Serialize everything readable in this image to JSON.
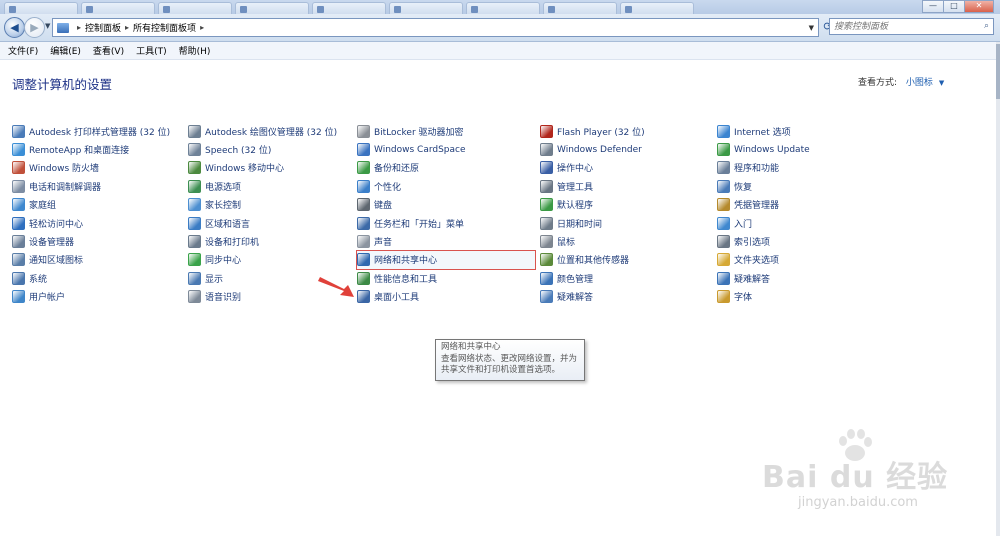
{
  "window": {
    "tabs_count": 9,
    "controls": {
      "minimize": "—",
      "maximize": "□",
      "close": "✕"
    }
  },
  "nav": {
    "back_icon": "back-arrow-icon",
    "breadcrumb": [
      "控制面板",
      "所有控制面板项"
    ],
    "search_placeholder": "搜索控制面板"
  },
  "menu": [
    "文件(F)",
    "编辑(E)",
    "查看(V)",
    "工具(T)",
    "帮助(H)"
  ],
  "header": {
    "title": "调整计算机的设置",
    "view_by_label": "查看方式:",
    "view_by_value": "小图标"
  },
  "columns": [
    [
      {
        "label": "Autodesk 打印样式管理器 (32 位)",
        "color": "#4a7bb8"
      },
      {
        "label": "RemoteApp 和桌面连接",
        "color": "#3b8fd6"
      },
      {
        "label": "Windows 防火墙",
        "color": "#c0503a"
      },
      {
        "label": "电话和调制解调器",
        "color": "#7d8da3"
      },
      {
        "label": "家庭组",
        "color": "#3f88cf"
      },
      {
        "label": "轻松访问中心",
        "color": "#2f6fbf"
      },
      {
        "label": "设备管理器",
        "color": "#6a7f99"
      },
      {
        "label": "通知区域图标",
        "color": "#5a7ea8"
      },
      {
        "label": "系统",
        "color": "#4a76ad"
      },
      {
        "label": "用户帐户",
        "color": "#3f86c9"
      }
    ],
    [
      {
        "label": "Autodesk 绘图仪管理器 (32 位)",
        "color": "#6d7f92"
      },
      {
        "label": "Speech (32 位)",
        "color": "#6f8298"
      },
      {
        "label": "Windows 移动中心",
        "color": "#4c8a3f"
      },
      {
        "label": "电源选项",
        "color": "#3d8f52"
      },
      {
        "label": "家长控制",
        "color": "#4d8fd1"
      },
      {
        "label": "区域和语言",
        "color": "#3b7cc4"
      },
      {
        "label": "设备和打印机",
        "color": "#6a7a8c"
      },
      {
        "label": "同步中心",
        "color": "#3aa34a"
      },
      {
        "label": "显示",
        "color": "#4a79b2"
      },
      {
        "label": "语音识别",
        "color": "#7e8a98"
      }
    ],
    [
      {
        "label": "BitLocker 驱动器加密",
        "color": "#8a8f96"
      },
      {
        "label": "Windows CardSpace",
        "color": "#3a73c0"
      },
      {
        "label": "备份和还原",
        "color": "#3b9a45"
      },
      {
        "label": "个性化",
        "color": "#3b7fc9"
      },
      {
        "label": "键盘",
        "color": "#5e6770"
      },
      {
        "label": "任务栏和「开始」菜单",
        "color": "#3c6aa8"
      },
      {
        "label": "声音",
        "color": "#8b94a0"
      },
      {
        "label": "网络和共享中心",
        "color": "#2f69b0",
        "highlight": true
      },
      {
        "label": "性能信息和工具",
        "color": "#3c8a45"
      },
      {
        "label": "桌面小工具",
        "color": "#3a66a5"
      }
    ],
    [
      {
        "label": "Flash Player (32 位)",
        "color": "#b1261c"
      },
      {
        "label": "Windows Defender",
        "color": "#6f7d8c"
      },
      {
        "label": "操作中心",
        "color": "#3a5fa5"
      },
      {
        "label": "管理工具",
        "color": "#6a7684"
      },
      {
        "label": "默认程序",
        "color": "#3b9a45"
      },
      {
        "label": "日期和时间",
        "color": "#6f7c8a"
      },
      {
        "label": "鼠标",
        "color": "#7d858f"
      },
      {
        "label": "位置和其他传感器",
        "color": "#5b8a3a"
      },
      {
        "label": "颜色管理",
        "color": "#3b73b7"
      },
      {
        "label": "疑难解答",
        "color": "#4a7bb8"
      }
    ],
    [
      {
        "label": "Internet 选项",
        "color": "#3b84d0"
      },
      {
        "label": "Windows Update",
        "color": "#3b9a45"
      },
      {
        "label": "程序和功能",
        "color": "#6a7f99"
      },
      {
        "label": "恢复",
        "color": "#4a7bb8"
      },
      {
        "label": "凭据管理器",
        "color": "#b58a2c"
      },
      {
        "label": "入门",
        "color": "#3f88cf"
      },
      {
        "label": "索引选项",
        "color": "#6a7684"
      },
      {
        "label": "文件夹选项",
        "color": "#d6a935"
      },
      {
        "label": "疑难解答",
        "color": "#3b73b7"
      },
      {
        "label": "字体",
        "color": "#c99a2e"
      }
    ]
  ],
  "tooltip": {
    "title": "网络和共享中心",
    "line1": "查看网络状态、更改网络设置，并为",
    "line2": "共享文件和打印机设置首选项。"
  },
  "watermark": {
    "main": "Bai du 经验",
    "sub": "jingyan.baidu.com"
  },
  "colors": {
    "link": "#1e3b78",
    "title": "#1e3287",
    "arrow": "#e0413a",
    "highlight_border": "#d9534f"
  }
}
